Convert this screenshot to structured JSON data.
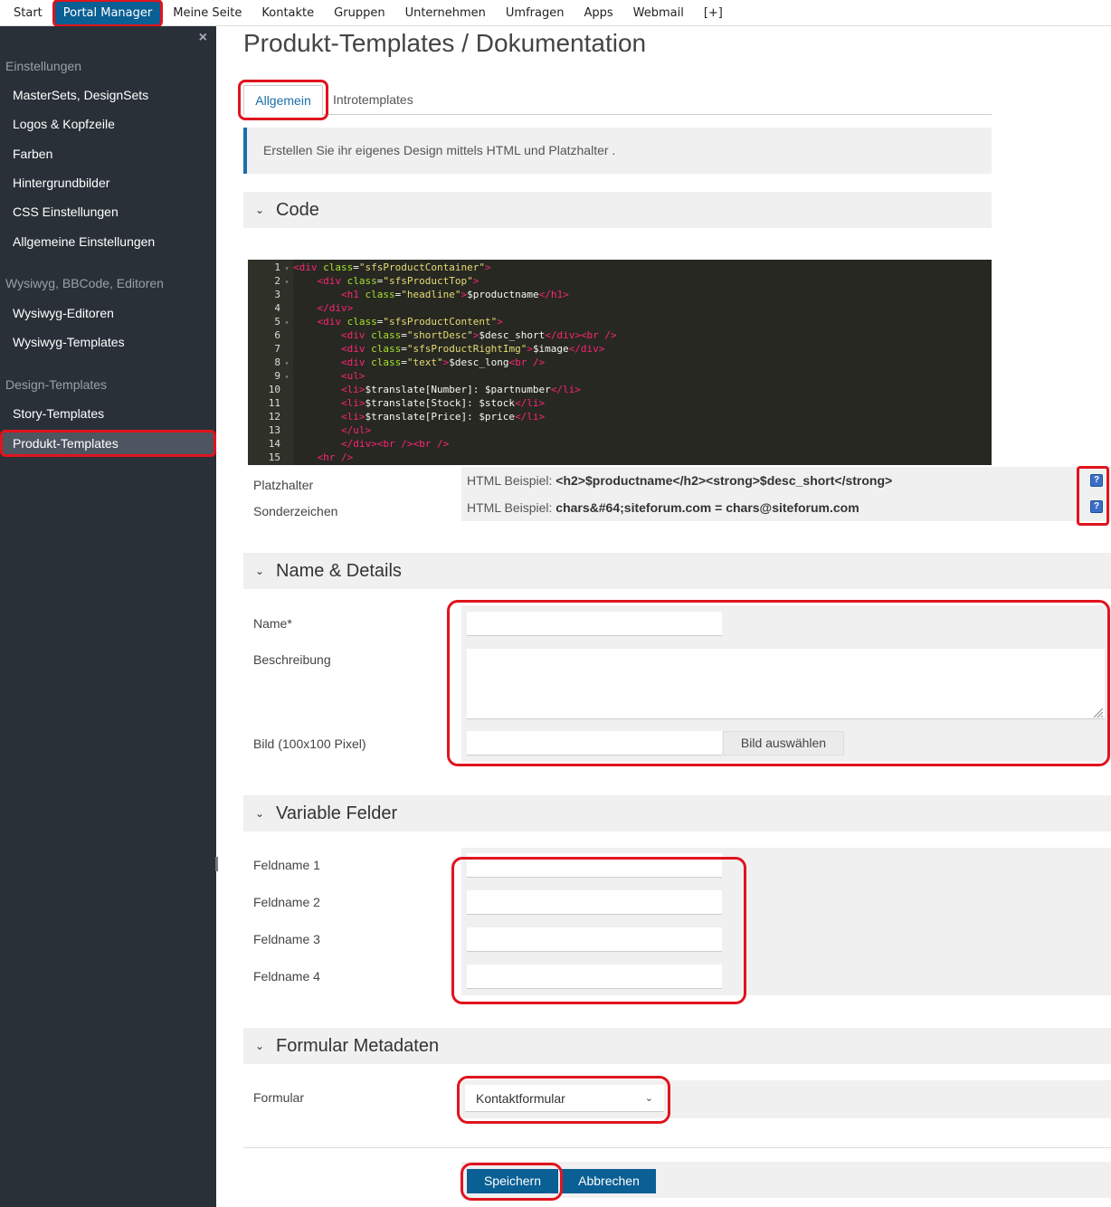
{
  "topnav": {
    "items": [
      "Start",
      "Portal Manager",
      "Meine Seite",
      "Kontakte",
      "Gruppen",
      "Unternehmen",
      "Umfragen",
      "Apps",
      "Webmail",
      "[+]"
    ],
    "active_index": 1
  },
  "sidebar": {
    "close_label": "×",
    "groups": [
      {
        "title": "Einstellungen",
        "items": [
          "MasterSets, DesignSets",
          "Logos & Kopfzeile",
          "Farben",
          "Hintergrundbilder",
          "CSS Einstellungen",
          "Allgemeine Einstellungen"
        ]
      },
      {
        "title": "Wysiwyg, BBCode, Editoren",
        "items": [
          "Wysiwyg-Editoren",
          "Wysiwyg-Templates"
        ]
      },
      {
        "title": "Design-Templates",
        "items": [
          "Story-Templates",
          "Produkt-Templates"
        ]
      }
    ],
    "active_item": "Produkt-Templates"
  },
  "page": {
    "title": "Produkt-Templates / Dokumentation",
    "tabs": [
      "Allgemein",
      "Introtemplates"
    ],
    "info": "Erstellen Sie ihr eigenes Design mittels HTML und Platzhalter ."
  },
  "sections": {
    "code": "Code",
    "name_details": "Name & Details",
    "variable": "Variable Felder",
    "meta": "Formular Metadaten"
  },
  "code_lines": [
    {
      "n": "1",
      "fold": true,
      "indent": 0,
      "parts": [
        [
          "tag",
          "<div "
        ],
        [
          "attr",
          "class"
        ],
        [
          "code",
          "="
        ],
        [
          "str",
          "\"sfsProductContainer\""
        ],
        [
          "tag",
          ">"
        ]
      ]
    },
    {
      "n": "2",
      "fold": true,
      "indent": 1,
      "parts": [
        [
          "tag",
          "<div "
        ],
        [
          "attr",
          "class"
        ],
        [
          "code",
          "="
        ],
        [
          "str",
          "\"sfsProductTop\""
        ],
        [
          "tag",
          ">"
        ]
      ]
    },
    {
      "n": "3",
      "fold": false,
      "indent": 2,
      "parts": [
        [
          "tag",
          "<h1 "
        ],
        [
          "attr",
          "class"
        ],
        [
          "code",
          "="
        ],
        [
          "str",
          "\"headline\""
        ],
        [
          "tag",
          ">"
        ],
        [
          "code",
          "$productname"
        ],
        [
          "tag",
          "</h1>"
        ]
      ]
    },
    {
      "n": "4",
      "fold": false,
      "indent": 1,
      "parts": [
        [
          "tag",
          "</div>"
        ]
      ]
    },
    {
      "n": "5",
      "fold": true,
      "indent": 1,
      "parts": [
        [
          "tag",
          "<div "
        ],
        [
          "attr",
          "class"
        ],
        [
          "code",
          "="
        ],
        [
          "str",
          "\"sfsProductContent\""
        ],
        [
          "tag",
          ">"
        ]
      ]
    },
    {
      "n": "6",
      "fold": false,
      "indent": 2,
      "parts": [
        [
          "tag",
          "<div "
        ],
        [
          "attr",
          "class"
        ],
        [
          "code",
          "="
        ],
        [
          "str",
          "\"shortDesc\""
        ],
        [
          "tag",
          ">"
        ],
        [
          "code",
          "$desc_short"
        ],
        [
          "tag",
          "</div><br />"
        ]
      ]
    },
    {
      "n": "7",
      "fold": false,
      "indent": 2,
      "parts": [
        [
          "tag",
          "<div "
        ],
        [
          "attr",
          "class"
        ],
        [
          "code",
          "="
        ],
        [
          "str",
          "\"sfsProductRightImg\""
        ],
        [
          "tag",
          ">"
        ],
        [
          "code",
          "$image"
        ],
        [
          "tag",
          "</div>"
        ]
      ]
    },
    {
      "n": "8",
      "fold": true,
      "indent": 2,
      "parts": [
        [
          "tag",
          "<div "
        ],
        [
          "attr",
          "class"
        ],
        [
          "code",
          "="
        ],
        [
          "str",
          "\"text\""
        ],
        [
          "tag",
          ">"
        ],
        [
          "code",
          "$desc_long"
        ],
        [
          "tag",
          "<br />"
        ]
      ]
    },
    {
      "n": "9",
      "fold": true,
      "indent": 2,
      "parts": [
        [
          "tag",
          "<ul>"
        ]
      ]
    },
    {
      "n": "10",
      "fold": false,
      "indent": 2,
      "parts": [
        [
          "tag",
          "<li>"
        ],
        [
          "code",
          "$translate[Number]: $partnumber"
        ],
        [
          "tag",
          "</li>"
        ]
      ]
    },
    {
      "n": "11",
      "fold": false,
      "indent": 2,
      "parts": [
        [
          "tag",
          "<li>"
        ],
        [
          "code",
          "$translate[Stock]: $stock"
        ],
        [
          "tag",
          "</li>"
        ]
      ]
    },
    {
      "n": "12",
      "fold": false,
      "indent": 2,
      "parts": [
        [
          "tag",
          "<li>"
        ],
        [
          "code",
          "$translate[Price]: $price"
        ],
        [
          "tag",
          "</li>"
        ]
      ]
    },
    {
      "n": "13",
      "fold": false,
      "indent": 2,
      "parts": [
        [
          "tag",
          "</ul>"
        ]
      ]
    },
    {
      "n": "14",
      "fold": false,
      "indent": 2,
      "parts": [
        [
          "tag",
          "</div><br /><br />"
        ]
      ]
    },
    {
      "n": "15",
      "fold": false,
      "indent": 1,
      "parts": [
        [
          "tag",
          "<hr />"
        ]
      ]
    }
  ],
  "placeholders": {
    "label1": "Platzhalter",
    "label2": "Sonderzeichen",
    "example_prefix": "HTML Beispiel:",
    "example1": "<h2>$productname</h2><strong>$desc_short</strong>",
    "example2": "chars&#64;siteforum.com = chars@siteforum.com",
    "help": "?"
  },
  "form": {
    "name_label": "Name*",
    "name_value": "",
    "desc_label": "Beschreibung",
    "desc_value": "",
    "image_label": "Bild (100x100 Pixel)",
    "image_value": "",
    "image_button": "Bild auswählen",
    "fields": [
      "Feldname 1",
      "Feldname 2",
      "Feldname 3",
      "Feldname 4"
    ],
    "formular_label": "Formular",
    "formular_value": "Kontaktformular",
    "save": "Speichern",
    "cancel": "Abbrechen"
  },
  "colors": {
    "primary": "#0a5f94",
    "sidebar": "#2a3038",
    "highlight": "#e0141e"
  }
}
